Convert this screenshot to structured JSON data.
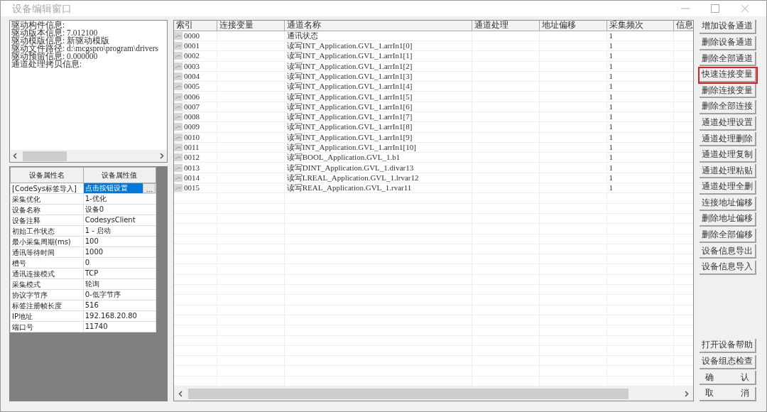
{
  "window": {
    "title": "设备编辑窗口"
  },
  "driver_info": {
    "lines": [
      "驱动构件信息:",
      "驱动版本信息: 7.012100",
      "驱动模版信息: 新驱动模版",
      "驱动文件路径: d:\\mcgspro\\program\\drivers",
      "驱动预留信息: 0.000000",
      "通道处理拷贝信息:"
    ]
  },
  "properties": {
    "columns": [
      "设备属性名",
      "设备属性值"
    ],
    "rows": [
      {
        "name": "[CodeSys标签导入]",
        "value": "点击按钮设置",
        "selected": true,
        "kind": "button"
      },
      {
        "name": "采集优化",
        "value": "1-优化",
        "selected": false,
        "kind": "text"
      },
      {
        "name": "设备名称",
        "value": "设备0",
        "selected": false,
        "kind": "text"
      },
      {
        "name": "设备注释",
        "value": "CodesysClient",
        "selected": false,
        "kind": "text"
      },
      {
        "name": "初始工作状态",
        "value": "1 - 启动",
        "selected": false,
        "kind": "text"
      },
      {
        "name": "最小采集周期(ms)",
        "value": "100",
        "selected": false,
        "kind": "text"
      },
      {
        "name": "通讯等待时间",
        "value": "1000",
        "selected": false,
        "kind": "text"
      },
      {
        "name": "槽号",
        "value": "0",
        "selected": false,
        "kind": "text"
      },
      {
        "name": "通讯连接模式",
        "value": "TCP",
        "selected": false,
        "kind": "text"
      },
      {
        "name": "采集模式",
        "value": "轮询",
        "selected": false,
        "kind": "text"
      },
      {
        "name": "协议字节序",
        "value": "0-低字节序",
        "selected": false,
        "kind": "text"
      },
      {
        "name": "标签注册帧长度",
        "value": "516",
        "selected": false,
        "kind": "text"
      },
      {
        "name": "IP地址",
        "value": "192.168.20.80",
        "selected": false,
        "kind": "text"
      },
      {
        "name": "端口号",
        "value": "11740",
        "selected": false,
        "kind": "text"
      }
    ]
  },
  "table": {
    "columns": [
      "索引",
      "连接变量",
      "通道名称",
      "通道处理",
      "地址偏移",
      "采集频次",
      "信息"
    ],
    "rows": [
      {
        "index": "0000",
        "name": "通讯状态",
        "frequency": "1"
      },
      {
        "index": "0001",
        "name": "读写INT_Application.GVL_1.arrIn1[0]",
        "frequency": "1"
      },
      {
        "index": "0002",
        "name": "读写INT_Application.GVL_1.arrIn1[1]",
        "frequency": "1"
      },
      {
        "index": "0003",
        "name": "读写INT_Application.GVL_1.arrIn1[2]",
        "frequency": "1"
      },
      {
        "index": "0004",
        "name": "读写INT_Application.GVL_1.arrIn1[3]",
        "frequency": "1"
      },
      {
        "index": "0005",
        "name": "读写INT_Application.GVL_1.arrIn1[4]",
        "frequency": "1"
      },
      {
        "index": "0006",
        "name": "读写INT_Application.GVL_1.arrIn1[5]",
        "frequency": "1"
      },
      {
        "index": "0007",
        "name": "读写INT_Application.GVL_1.arrIn1[6]",
        "frequency": "1"
      },
      {
        "index": "0008",
        "name": "读写INT_Application.GVL_1.arrIn1[7]",
        "frequency": "1"
      },
      {
        "index": "0009",
        "name": "读写INT_Application.GVL_1.arrIn1[8]",
        "frequency": "1"
      },
      {
        "index": "0010",
        "name": "读写INT_Application.GVL_1.arrIn1[9]",
        "frequency": "1"
      },
      {
        "index": "0011",
        "name": "读写INT_Application.GVL_1.arrIn1[10]",
        "frequency": "1"
      },
      {
        "index": "0012",
        "name": "读写BOOL_Application.GVL_1.b1",
        "frequency": "1"
      },
      {
        "index": "0013",
        "name": "读写DINT_Application.GVL_1.divar13",
        "frequency": "1"
      },
      {
        "index": "0014",
        "name": "读写LREAL_Application.GVL_1.lrvar12",
        "frequency": "1"
      },
      {
        "index": "0015",
        "name": "读写REAL_Application.GVL_1.rvar11",
        "frequency": "1"
      }
    ]
  },
  "buttons": [
    {
      "label": "增加设备通道",
      "highlighted": false
    },
    {
      "label": "删除设备通道",
      "highlighted": false
    },
    {
      "label": "删除全部通道",
      "highlighted": false
    },
    {
      "label": "快速连接变量",
      "highlighted": true
    },
    {
      "label": "删除连接变量",
      "highlighted": false
    },
    {
      "label": "删除全部连接",
      "highlighted": false
    },
    {
      "label": "通道处理设置",
      "highlighted": false
    },
    {
      "label": "通道处理删除",
      "highlighted": false
    },
    {
      "label": "通道处理复制",
      "highlighted": false
    },
    {
      "label": "通道处理粘贴",
      "highlighted": false
    },
    {
      "label": "通道处理全删",
      "highlighted": false
    },
    {
      "label": "连接地址偏移",
      "highlighted": false
    },
    {
      "label": "删除地址偏移",
      "highlighted": false
    },
    {
      "label": "删除全部偏移",
      "highlighted": false
    },
    {
      "label": "设备信息导出",
      "highlighted": false
    },
    {
      "label": "设备信息导入",
      "highlighted": false
    }
  ],
  "bottom_buttons": [
    {
      "label": "打开设备帮助"
    },
    {
      "label": "设备组态检查"
    },
    {
      "label": "确 认"
    },
    {
      "label": "取 消"
    }
  ]
}
